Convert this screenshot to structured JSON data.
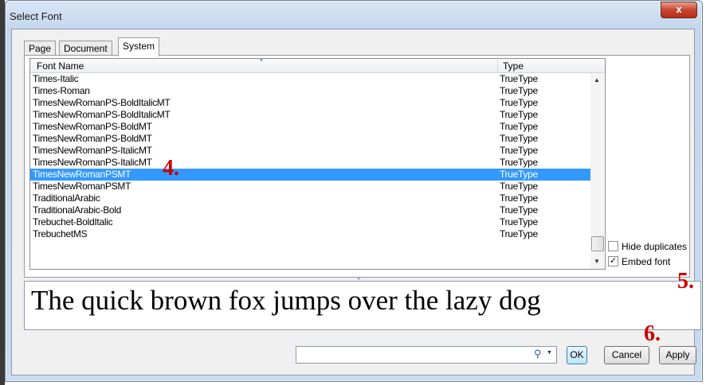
{
  "dialog": {
    "title": "Select Font",
    "close_glyph": "x",
    "tabs": [
      {
        "label": "Page"
      },
      {
        "label": "Document"
      },
      {
        "label": "System",
        "active": true
      }
    ]
  },
  "font_list": {
    "headers": {
      "name": "Font Name",
      "type": "Type"
    },
    "selected_index": 8,
    "rows": [
      {
        "name": "Times-Italic",
        "type": "TrueType"
      },
      {
        "name": "Times-Roman",
        "type": "TrueType"
      },
      {
        "name": "TimesNewRomanPS-BoldItalicMT",
        "type": "TrueType"
      },
      {
        "name": "TimesNewRomanPS-BoldItalicMT",
        "type": "TrueType"
      },
      {
        "name": "TimesNewRomanPS-BoldMT",
        "type": "TrueType"
      },
      {
        "name": "TimesNewRomanPS-BoldMT",
        "type": "TrueType"
      },
      {
        "name": "TimesNewRomanPS-ItalicMT",
        "type": "TrueType"
      },
      {
        "name": "TimesNewRomanPS-ItalicMT",
        "type": "TrueType"
      },
      {
        "name": "TimesNewRomanPSMT",
        "type": "TrueType"
      },
      {
        "name": "TimesNewRomanPSMT",
        "type": "TrueType"
      },
      {
        "name": "TraditionalArabic",
        "type": "TrueType"
      },
      {
        "name": "TraditionalArabic-Bold",
        "type": "TrueType"
      },
      {
        "name": "Trebuchet-BoldItalic",
        "type": "TrueType"
      },
      {
        "name": "TrebuchetMS",
        "type": "TrueType"
      }
    ]
  },
  "options": {
    "hide_duplicates": {
      "label": "Hide duplicates",
      "checked": false
    },
    "embed_font": {
      "label": "Embed font",
      "checked": true
    }
  },
  "preview": {
    "text": "The quick brown fox jumps over the lazy dog"
  },
  "footer": {
    "search_value": "",
    "ok_label": "OK",
    "cancel_label": "Cancel",
    "apply_label": "Apply"
  },
  "annotations": {
    "step4": "4.",
    "step5": "5.",
    "step6": "6."
  },
  "colors": {
    "selection": "#3399ff",
    "annotation": "#cc0000"
  }
}
